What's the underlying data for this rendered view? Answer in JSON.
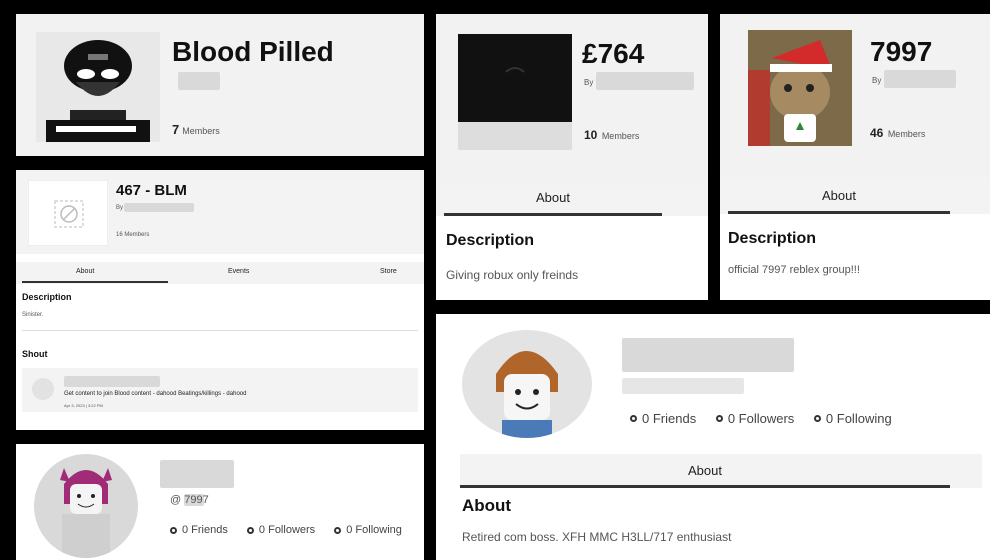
{
  "groups": {
    "blood_pilled": {
      "name": "Blood Pilled",
      "members_count": "7",
      "members_label": "Members"
    },
    "pound": {
      "name": "£764",
      "by": "By",
      "members_count": "10",
      "members_label": "Members",
      "tab": "About",
      "description_heading": "Description",
      "description": "Giving robux only freinds"
    },
    "g7997": {
      "name": "7997",
      "by": "By",
      "members_count": "46",
      "members_label": "Members",
      "tab": "About",
      "description_heading": "Description",
      "description": "official 7997 reblex group!!!"
    },
    "blm": {
      "name": "467 - BLM",
      "by": "By",
      "members": "16 Members",
      "tabs": [
        "About",
        "Events",
        "Store"
      ],
      "description_heading": "Description",
      "description": "Sinister.",
      "shout_heading": "Shout",
      "shout_text": "Get content to join Blood content - dahood Beatings/killings - dahood",
      "shout_time": "Apr 3, 2023 | 3:22 PM"
    }
  },
  "profiles": {
    "small": {
      "handle": "@ 7997",
      "stats": [
        "0 Friends",
        "0 Followers",
        "0 Following"
      ]
    },
    "large": {
      "stats": [
        "0 Friends",
        "0 Followers",
        "0 Following"
      ],
      "tab": "About",
      "about_heading": "About",
      "about_text": "Retired com boss. XFH MMC H3LL/717 enthusiast"
    }
  },
  "colors": {
    "border": "#000000",
    "panel": "#f2f2f2",
    "underline": "#333333"
  },
  "icons": {
    "broken_image": "broken-image-icon",
    "zero": "ring"
  }
}
